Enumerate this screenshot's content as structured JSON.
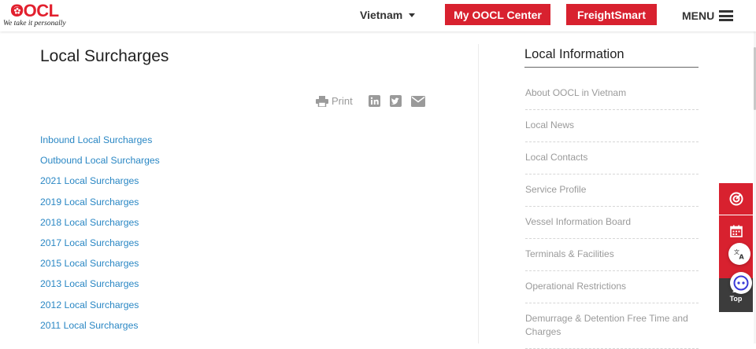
{
  "header": {
    "logo_text": "OOCL",
    "logo_tagline": "We take it personally",
    "country": "Vietnam",
    "my_oocl_label": "My OOCL Center",
    "freightsmart_label": "FreightSmart",
    "menu_label": "MENU"
  },
  "main": {
    "title": "Local Surcharges",
    "print_label": "Print",
    "links": [
      "Inbound Local Surcharges",
      "Outbound Local Surcharges",
      "2021 Local Surcharges",
      "2019 Local Surcharges",
      "2018 Local Surcharges",
      "2017 Local Surcharges",
      "2015 Local Surcharges",
      "2013 Local Surcharges",
      "2012 Local Surcharges",
      "2011 Local Surcharges"
    ]
  },
  "sidebar": {
    "title": "Local Information",
    "items": [
      "About OOCL in Vietnam",
      "Local News",
      "Local Contacts",
      "Service Profile",
      "Vessel Information Board",
      "Terminals & Facilities",
      "Operational Restrictions",
      "Demurrage & Detention Free Time and Charges"
    ]
  },
  "floating": {
    "top_label": "Top"
  },
  "colors": {
    "brand_red": "#d8212f",
    "link_blue": "#2a87c4",
    "muted_gray": "#9a9a9a"
  },
  "icons": [
    "print-icon",
    "linkedin-icon",
    "twitter-icon",
    "email-icon",
    "radar-icon",
    "calendar-icon",
    "translate-icon",
    "chat-icon",
    "arrow-up-icon"
  ]
}
